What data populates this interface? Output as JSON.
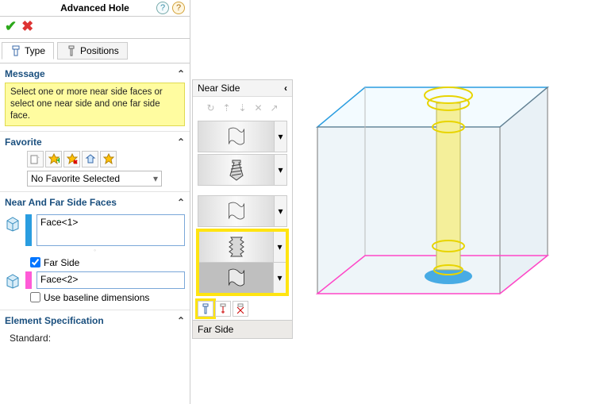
{
  "header": {
    "title": "Advanced Hole"
  },
  "tabs": {
    "type_label": "Type",
    "positions_label": "Positions"
  },
  "message": {
    "heading": "Message",
    "body": "Select one or more near side faces or select one near side and one far side face."
  },
  "favorite": {
    "heading": "Favorite",
    "selected": "No Favorite Selected"
  },
  "faces": {
    "heading": "Near And Far Side Faces",
    "near_value": "Face<1>",
    "far_checkbox": "Far Side",
    "far_value": "Face<2>",
    "baseline_checkbox": "Use baseline dimensions",
    "colors": {
      "near": "#2a9de0",
      "far": "#ff5bd7"
    }
  },
  "elem_spec": {
    "heading": "Element Specification",
    "standard_label": "Standard:"
  },
  "col2": {
    "near_heading": "Near Side",
    "far_heading": "Far Side"
  }
}
